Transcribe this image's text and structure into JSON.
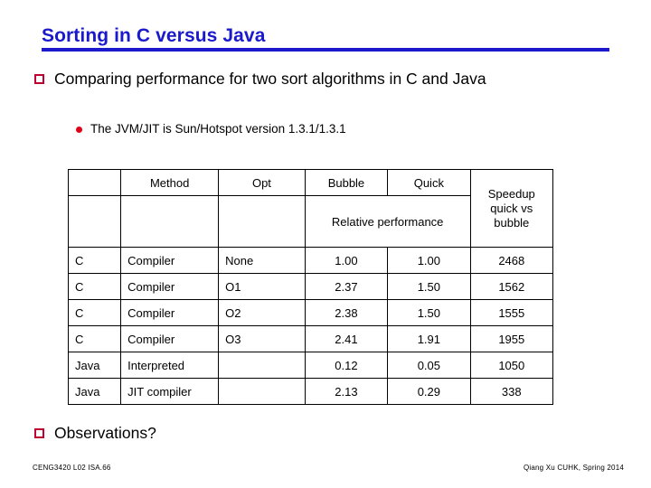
{
  "slide": {
    "title": "Sorting in C versus Java",
    "title_color": "#1A1ACC",
    "bullet_marker_color": "#C00030",
    "subbullet_marker_color": "#E00018"
  },
  "bullets": {
    "main": "Comparing performance for two sort algorithms in C and Java",
    "sub": "The JVM/JIT is Sun/Hotspot version 1.3.1/1.3.1",
    "observations": "Observations?"
  },
  "table": {
    "header_row1": {
      "lang": "",
      "method": "Method",
      "opt": "Opt",
      "bubble": "Bubble",
      "quick": "Quick",
      "speedup": "Speedup quick vs bubble"
    },
    "header_row2": {
      "lang": "",
      "method": "",
      "opt": "",
      "relative_performance": "Relative performance"
    },
    "columns": [
      "",
      "Method",
      "Opt",
      "Bubble",
      "Quick",
      "Speedup quick vs bubble"
    ],
    "rows": [
      {
        "lang": "C",
        "method": "Compiler",
        "opt": "None",
        "bubble": "1.00",
        "quick": "1.00",
        "speedup": "2468"
      },
      {
        "lang": "C",
        "method": "Compiler",
        "opt": "O1",
        "bubble": "2.37",
        "quick": "1.50",
        "speedup": "1562"
      },
      {
        "lang": "C",
        "method": "Compiler",
        "opt": "O2",
        "bubble": "2.38",
        "quick": "1.50",
        "speedup": "1555"
      },
      {
        "lang": "C",
        "method": "Compiler",
        "opt": "O3",
        "bubble": "2.41",
        "quick": "1.91",
        "speedup": "1955"
      },
      {
        "lang": "Java",
        "method": "Interpreted",
        "opt": "",
        "bubble": "0.12",
        "quick": "0.05",
        "speedup": "1050"
      },
      {
        "lang": "Java",
        "method": "JIT compiler",
        "opt": "",
        "bubble": "2.13",
        "quick": "0.29",
        "speedup": "338"
      }
    ]
  },
  "footer": {
    "left": "CENG3420 L02 ISA.66",
    "right": "Qiang Xu  CUHK, Spring 2014"
  }
}
